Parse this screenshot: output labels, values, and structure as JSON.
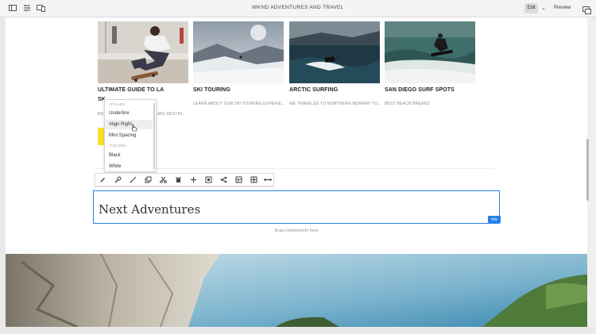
{
  "topbar": {
    "page_title": "WKND ADVENTURES AND TRAVEL",
    "edit_label": "Edit",
    "preview_label": "Preview"
  },
  "cards": [
    {
      "title": "ULTIMATE GUIDE TO LA",
      "title_line2": "SK",
      "description": "BR",
      "description_tail": "ATE DESTIN..."
    },
    {
      "title": "SKI TOURING",
      "description": "LEARN ABOUT OUR SKI TOURING EXPERIE..."
    },
    {
      "title": "ARCTIC SURFING",
      "description": "WE TRAVELED TO NORTHERN NORWAY TO..."
    },
    {
      "title": "SAN DIEGO SURF SPOTS",
      "description": "BEST BEACH BREAKS"
    }
  ],
  "styles_menu": {
    "styles_heading": "STYLES",
    "style_items": [
      "Underline",
      "Align Right",
      "Mini Spacing"
    ],
    "hovered_item": "Align Right",
    "colors_heading": "COLORS",
    "color_items": [
      "Black",
      "White"
    ]
  },
  "toolbar": {
    "icons": [
      "pencil-icon",
      "wrench-icon",
      "brush-icon",
      "copy-icon",
      "cut-icon",
      "delete-icon",
      "add-icon",
      "group-icon",
      "parent-icon",
      "layout-icon",
      "grid-icon",
      "more-icon"
    ]
  },
  "title_component": {
    "text": "Next Adventures",
    "badge": "Title"
  },
  "drop_zone": {
    "text": "Drag components here"
  },
  "colors": {
    "accent": "#2680eb",
    "yellow": "#f5df2d"
  }
}
